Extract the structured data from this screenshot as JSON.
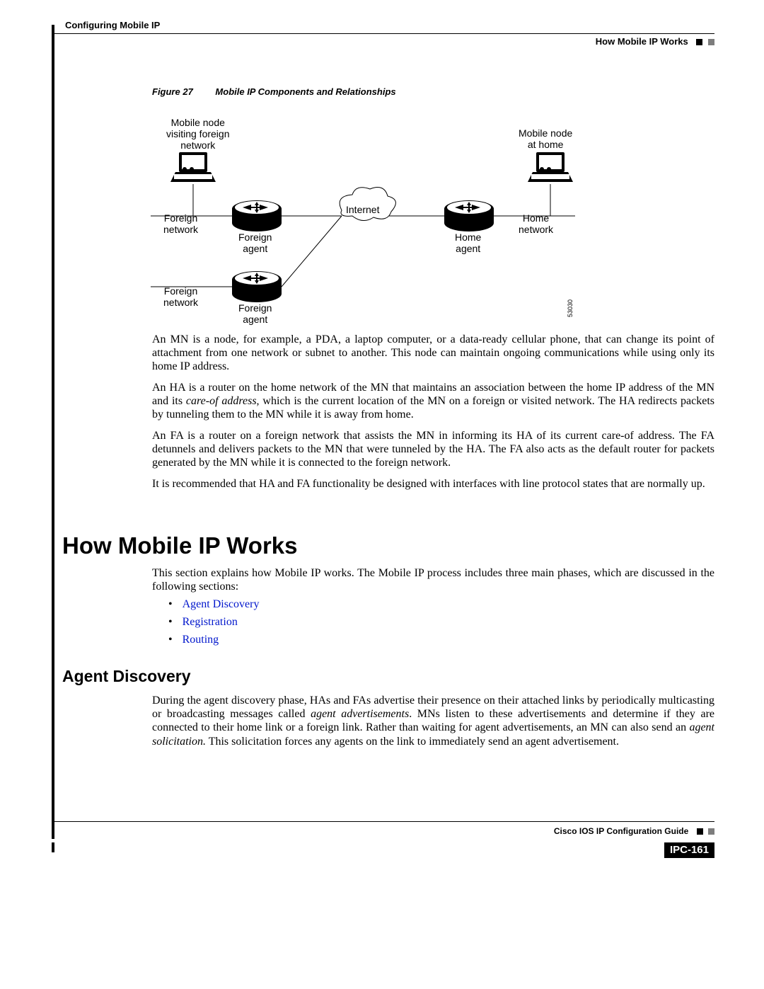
{
  "header": {
    "chapter": "Configuring Mobile IP",
    "section": "How Mobile IP Works"
  },
  "figure": {
    "number": "Figure 27",
    "title": "Mobile IP Components and Relationships",
    "id": "53030",
    "labels": {
      "mn_foreign": "Mobile node\nvisiting foreign\nnetwork",
      "mn_home": "Mobile node\nat home",
      "foreign_net1": "Foreign\nnetwork",
      "foreign_net2": "Foreign\nnetwork",
      "foreign_agent1": "Foreign\nagent",
      "foreign_agent2": "Foreign\nagent",
      "internet": "Internet",
      "home_agent": "Home\nagent",
      "home_net": "Home\nnetwork"
    }
  },
  "paragraphs": {
    "p1": "An MN is a node, for example, a PDA, a laptop computer, or a data-ready cellular phone, that can change its point of attachment from one network or subnet to another. This node can maintain ongoing communications while using only its home IP address.",
    "p2a": "An HA is a router on the home network of the MN that maintains an association between the home IP address of the MN and its ",
    "p2b": "care-of address",
    "p2c": ", which is the current location of the MN on a foreign or visited network. The HA redirects packets by tunneling them to the MN while it is away from home.",
    "p3": "An FA is a router on a foreign network that assists the MN in informing its HA of its current care-of address. The FA detunnels and delivers packets to the MN that were tunneled by the HA. The FA also acts as the default router for packets generated by the MN while it is connected to the foreign network.",
    "p4": "It is recommended that HA and FA functionality be designed with interfaces with line protocol states that are normally up."
  },
  "h1": "How Mobile IP Works",
  "intro": "This section explains how Mobile IP works. The Mobile IP process includes three main phases, which are discussed in the following sections:",
  "bullets": {
    "b1": "Agent Discovery",
    "b2": "Registration",
    "b3": "Routing"
  },
  "h2": "Agent Discovery",
  "discovery": {
    "a": "During the agent discovery phase, HAs and FAs advertise their presence on their attached links by periodically multicasting or broadcasting messages called ",
    "b": "agent advertisements",
    "c": ". MNs listen to these advertisements and determine if they are connected to their home link or a foreign link. Rather than waiting for agent advertisements, an MN can also send an ",
    "d": "agent solicitation.",
    "e": " This solicitation forces any agents on the link to immediately send an agent advertisement."
  },
  "footer": {
    "guide": "Cisco IOS IP Configuration Guide",
    "page": "IPC-161"
  }
}
